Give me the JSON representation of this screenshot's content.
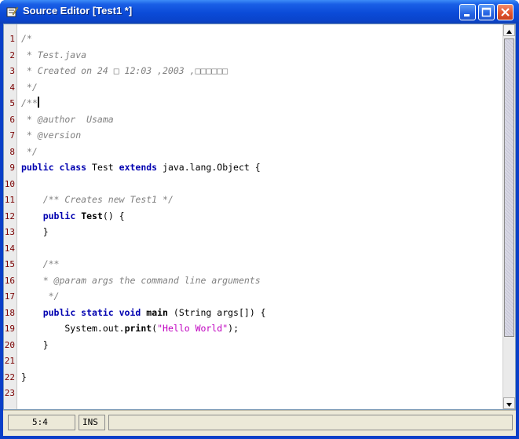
{
  "window": {
    "title": "Source Editor [Test1 *]"
  },
  "editor": {
    "lines": [
      {
        "n": "1",
        "segs": [
          [
            "c",
            "/*"
          ]
        ]
      },
      {
        "n": "2",
        "segs": [
          [
            "c",
            " * Test.java"
          ]
        ]
      },
      {
        "n": "3",
        "segs": [
          [
            "c",
            " * Created on 24 □ 12:03 ,2003 ,□□□□□□"
          ]
        ]
      },
      {
        "n": "4",
        "segs": [
          [
            "c",
            " */"
          ]
        ]
      },
      {
        "n": "5",
        "segs": [
          [
            "c",
            "/**"
          ],
          [
            "caret",
            ""
          ]
        ]
      },
      {
        "n": "6",
        "segs": [
          [
            "c",
            " * @author  Usama"
          ]
        ]
      },
      {
        "n": "7",
        "segs": [
          [
            "c",
            " * @version"
          ]
        ]
      },
      {
        "n": "8",
        "segs": [
          [
            "c",
            " */"
          ]
        ]
      },
      {
        "n": "9",
        "segs": [
          [
            "k",
            "public class"
          ],
          [
            "t",
            " Test "
          ],
          [
            "k",
            "extends"
          ],
          [
            "t",
            " java.lang.Object {"
          ]
        ]
      },
      {
        "n": "10",
        "segs": []
      },
      {
        "n": "11",
        "segs": [
          [
            "t",
            "    "
          ],
          [
            "c",
            "/** Creates new Test1 */"
          ]
        ]
      },
      {
        "n": "12",
        "segs": [
          [
            "t",
            "    "
          ],
          [
            "k",
            "public"
          ],
          [
            "t",
            " "
          ],
          [
            "b",
            "Test"
          ],
          [
            "t",
            "() {"
          ]
        ]
      },
      {
        "n": "13",
        "segs": [
          [
            "t",
            "    }"
          ]
        ]
      },
      {
        "n": "14",
        "segs": []
      },
      {
        "n": "15",
        "segs": [
          [
            "t",
            "    "
          ],
          [
            "c",
            "/**"
          ]
        ]
      },
      {
        "n": "16",
        "segs": [
          [
            "t",
            "    "
          ],
          [
            "c",
            "* @param args the command line arguments"
          ]
        ]
      },
      {
        "n": "17",
        "segs": [
          [
            "t",
            "     "
          ],
          [
            "c",
            "*/"
          ]
        ]
      },
      {
        "n": "18",
        "segs": [
          [
            "t",
            "    "
          ],
          [
            "k",
            "public static void"
          ],
          [
            "t",
            " "
          ],
          [
            "b",
            "main"
          ],
          [
            "t",
            " (String args[]) {"
          ]
        ]
      },
      {
        "n": "19",
        "segs": [
          [
            "t",
            "        System.out."
          ],
          [
            "b",
            "print"
          ],
          [
            "t",
            "("
          ],
          [
            "s",
            "\"Hello World\""
          ],
          [
            "t",
            ");"
          ]
        ]
      },
      {
        "n": "20",
        "segs": [
          [
            "t",
            "    }"
          ]
        ]
      },
      {
        "n": "21",
        "segs": []
      },
      {
        "n": "22",
        "segs": [
          [
            "t",
            "}"
          ]
        ]
      },
      {
        "n": "23",
        "segs": []
      }
    ]
  },
  "statusbar": {
    "position": "5:4",
    "mode": "INS"
  }
}
